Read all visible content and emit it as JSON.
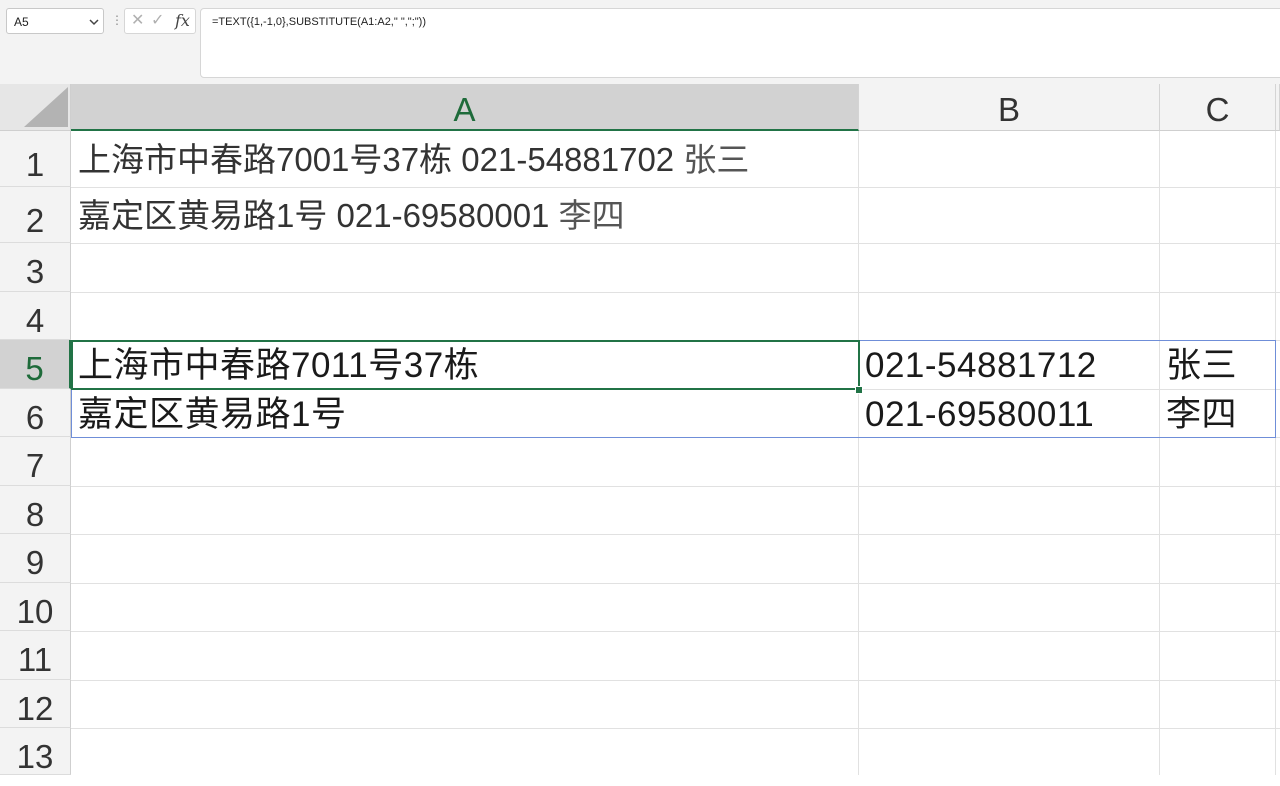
{
  "toolbar": {
    "name_box": "A5",
    "formula": "=TEXT({1,-1,0},SUBSTITUTE(A1:A2,\" \",\";\"))",
    "fx_label": "fx",
    "cancel_glyph": "✕",
    "enter_glyph": "✓"
  },
  "columns": [
    {
      "label": "A",
      "selected": true
    },
    {
      "label": "B",
      "selected": false
    },
    {
      "label": "C",
      "selected": false
    }
  ],
  "rows": [
    "1",
    "2",
    "3",
    "4",
    "5",
    "6",
    "7",
    "8",
    "9",
    "10",
    "11",
    "12",
    "13"
  ],
  "selected_row": "5",
  "cells": {
    "A1": {
      "address": "上海市中春路7001号37栋 021-54881702 ",
      "name": "张三"
    },
    "A2": {
      "address": "嘉定区黄易路1号 021-69580001 ",
      "name": "李四"
    },
    "A5": "上海市中春路7011号37栋",
    "B5": "021-54881712",
    "C5": "张三",
    "A6": "嘉定区黄易路1号",
    "B6": "021-69580011",
    "C6": "李四"
  },
  "icons": {
    "name_box_dropdown": "chevron-down-icon",
    "select_all": "select-all-triangle-icon",
    "cancel": "close-icon",
    "enter": "check-icon",
    "insert_function": "fx-icon"
  },
  "colors": {
    "accent": "#217346",
    "spill_border": "#6f8ed8",
    "header_bg": "#f3f3f3",
    "header_selected_bg": "#d2d2d2"
  }
}
